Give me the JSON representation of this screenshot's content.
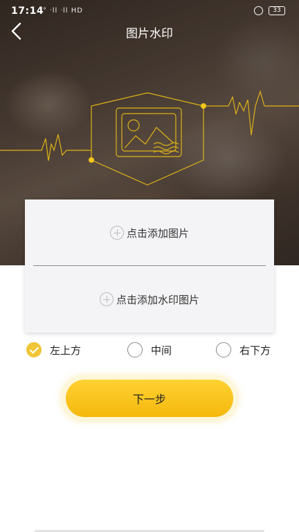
{
  "status_bar": {
    "time": "17:14",
    "signal": "° ᐧll ᐧll HD",
    "battery": "33"
  },
  "header": {
    "title": "图片水印"
  },
  "card": {
    "add_image": "点击添加图片",
    "add_watermark": "点击添加水印图片"
  },
  "position_options": {
    "items": [
      {
        "label": "左上方",
        "checked": true
      },
      {
        "label": "中间",
        "checked": false
      },
      {
        "label": "右下方",
        "checked": false
      }
    ]
  },
  "actions": {
    "next_label": "下一步"
  },
  "colors": {
    "accent": "#f5c518",
    "logo_line": "#e0b417"
  }
}
